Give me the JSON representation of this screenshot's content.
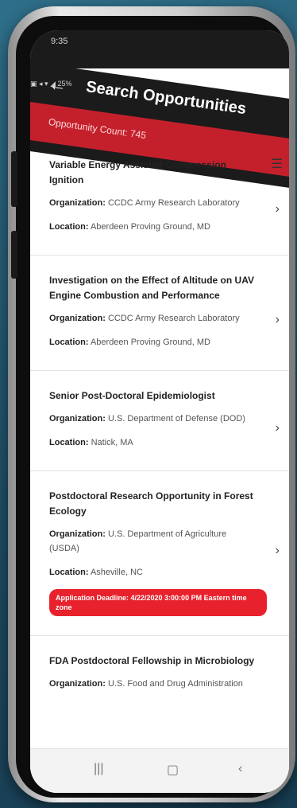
{
  "status": {
    "time": "9:35",
    "icons": "▣ ◂ ▾ ◢ 25%"
  },
  "header": {
    "title": "Search Opportunities",
    "back_icon": "back-arrow-icon",
    "menu_icon": "hamburger-menu-icon"
  },
  "count": {
    "label": "Opportunity Count: 745"
  },
  "labels": {
    "organization": "Organization:",
    "location": "Location:"
  },
  "items": [
    {
      "title": "Variable Energy Assisted Compression Ignition",
      "organization": "CCDC Army Research Laboratory",
      "location": "Aberdeen Proving Ground, MD"
    },
    {
      "title": "Investigation on the Effect of Altitude on UAV Engine Combustion and Performance",
      "organization": "CCDC Army Research Laboratory",
      "location": "Aberdeen Proving Ground, MD"
    },
    {
      "title": "Senior Post-Doctoral Epidemiologist",
      "organization": "U.S. Department of Defense (DOD)",
      "location": "Natick, MA"
    },
    {
      "title": "Postdoctoral Research Opportunity in Forest Ecology",
      "organization": "U.S. Department of Agriculture (USDA)",
      "location": "Asheville, NC",
      "deadline": "Application Deadline: 4/22/2020 3:00:00 PM Eastern time zone"
    },
    {
      "title": "FDA Postdoctoral Fellowship in Microbiology",
      "organization": "U.S. Food and Drug Administration",
      "location": ""
    }
  ],
  "nav": {
    "recents": "|||",
    "home": "▢",
    "back": "‹"
  },
  "colors": {
    "accent_red": "#c4202c",
    "deadline_red": "#e8222c",
    "app_bar": "#1b1b1b"
  }
}
